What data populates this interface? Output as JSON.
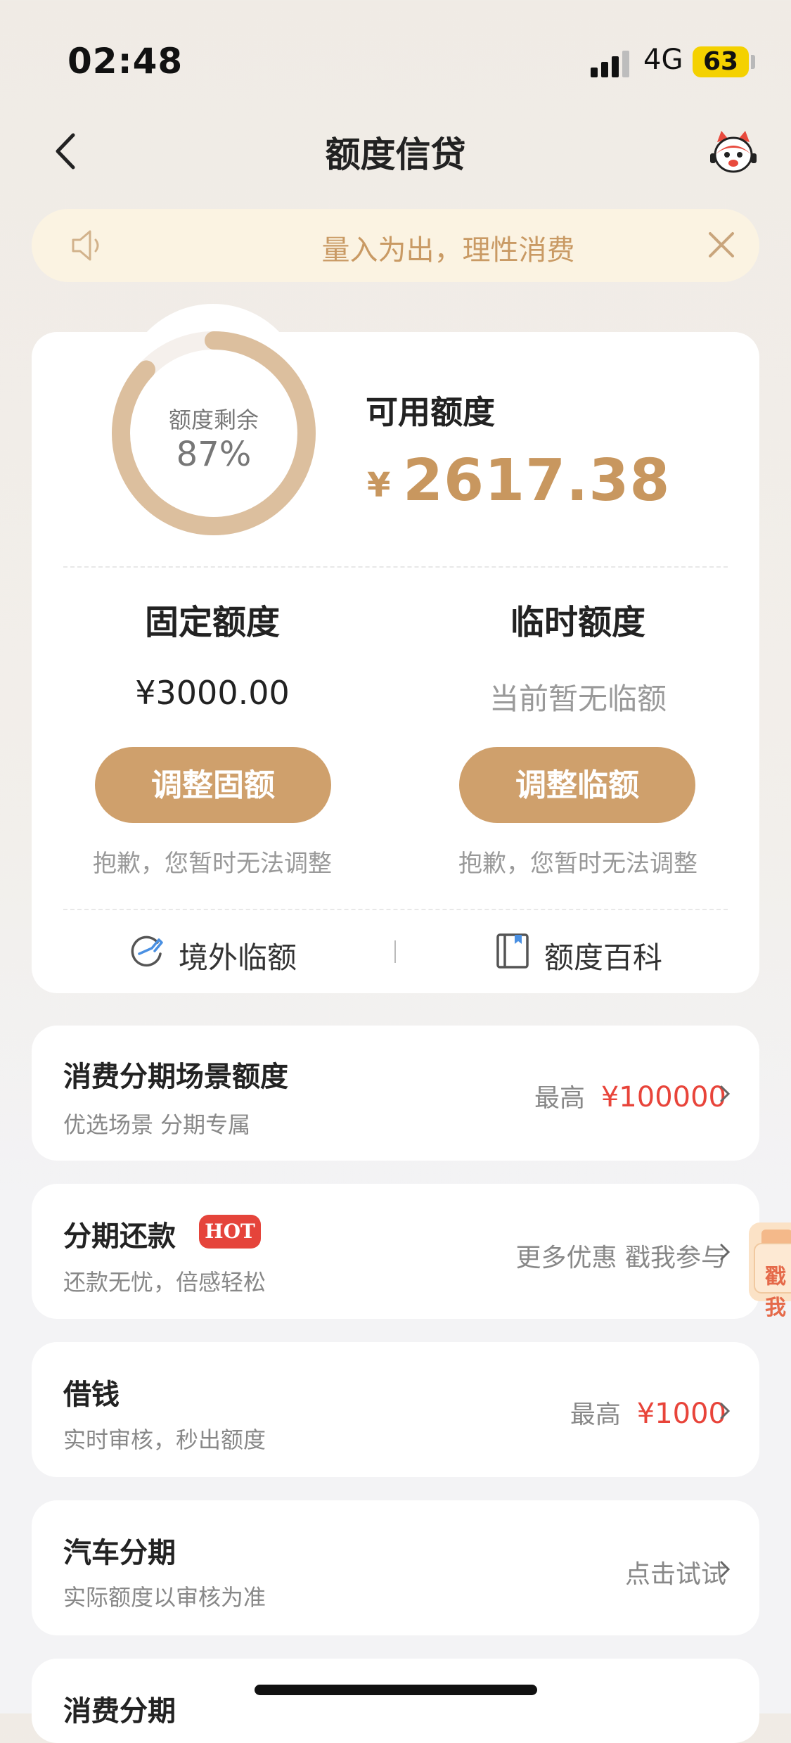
{
  "status_bar": {
    "time": "02:48",
    "network": "4G",
    "battery": "63"
  },
  "nav": {
    "title": "额度信贷"
  },
  "notice": {
    "text": "量入为出，理性消费"
  },
  "quota": {
    "ring_label": "额度剩余",
    "ring_percent": "87%",
    "ring_fraction": 0.87,
    "available_label": "可用额度",
    "currency": "¥",
    "available_amount": "2617.38",
    "fixed": {
      "title": "固定额度",
      "value": "¥3000.00",
      "button": "调整固额",
      "note": "抱歉，您暂时无法调整"
    },
    "temporary": {
      "title": "临时额度",
      "value": "当前暂无临额",
      "button": "调整临额",
      "note": "抱歉，您暂时无法调整"
    },
    "links": {
      "overseas": "境外临额",
      "wiki": "额度百科"
    }
  },
  "rows": [
    {
      "title": "消费分期场景额度",
      "subtitle": "优选场景 分期专属",
      "right_prefix": "最高",
      "right_value": "¥100000"
    },
    {
      "title": "分期还款",
      "badge": "HOT",
      "subtitle": "还款无忧，倍感轻松",
      "right_text": "更多优惠 戳我参与"
    },
    {
      "title": "借钱",
      "subtitle": "实时审核，秒出额度",
      "right_prefix": "最高",
      "right_value": "¥1000"
    },
    {
      "title": "汽车分期",
      "subtitle": "实际额度以审核为准",
      "right_text": "点击试试"
    },
    {
      "title": "消费分期"
    }
  ],
  "float_badge": {
    "text": "戳我"
  },
  "colors": {
    "accent": "#cfa06c",
    "accent_text": "#c8975f",
    "red": "#e8443a",
    "notice_bg": "#fbf3e2"
  }
}
